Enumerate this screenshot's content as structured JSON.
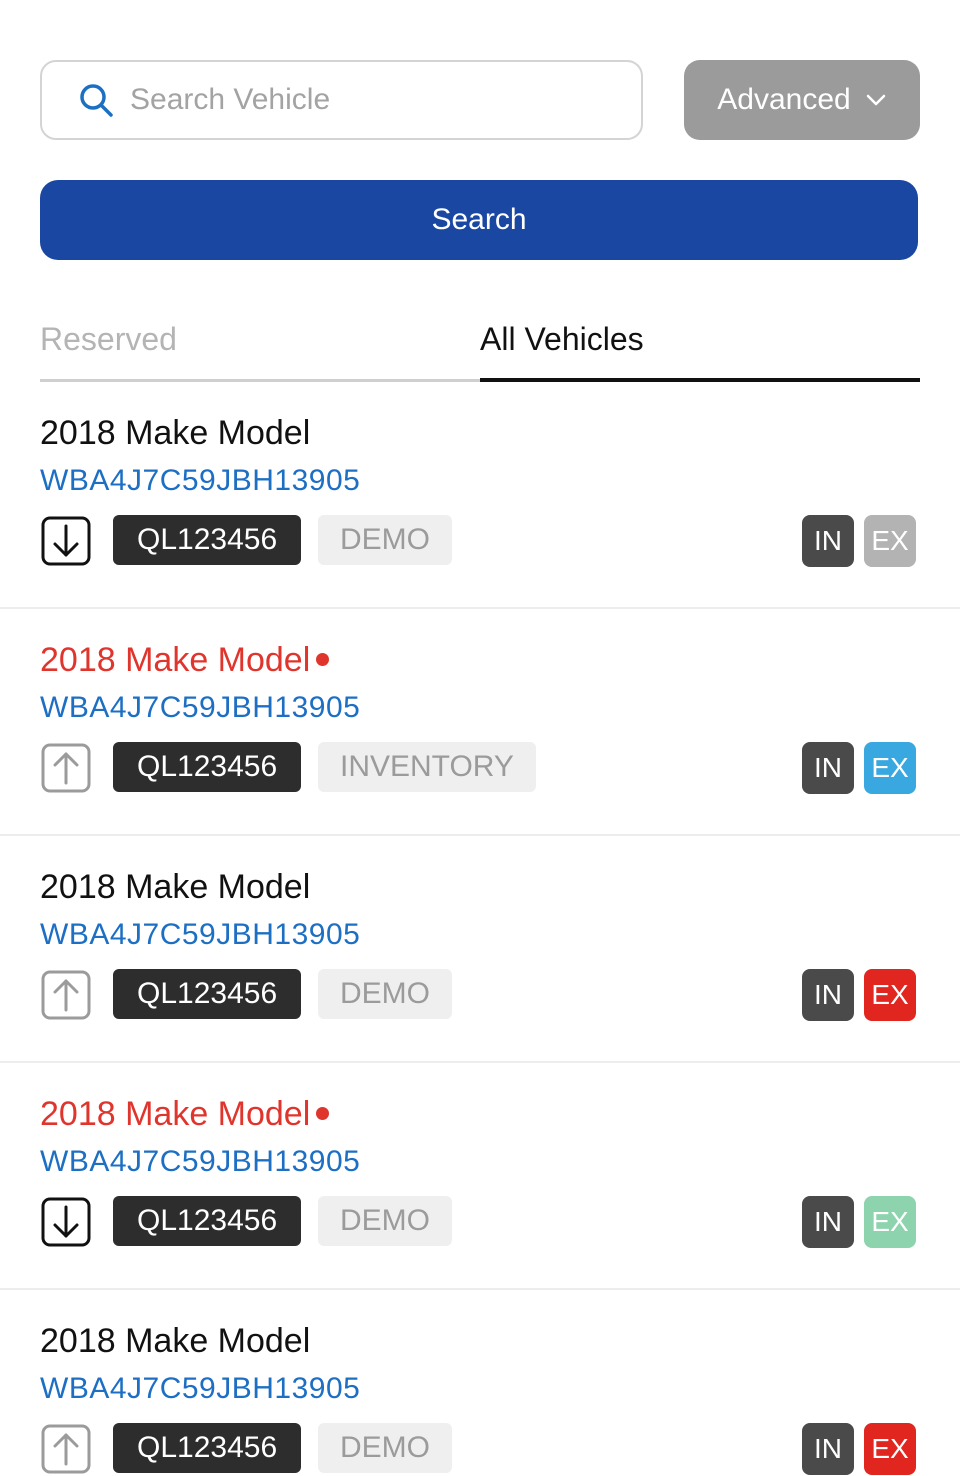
{
  "search": {
    "placeholder": "Search Vehicle",
    "advanced_label": "Advanced",
    "search_button_label": "Search"
  },
  "tabs": [
    {
      "label": "Reserved",
      "active": false
    },
    {
      "label": "All Vehicles",
      "active": true
    }
  ],
  "vehicles": [
    {
      "title": "2018 Make Model",
      "alert": false,
      "vin": "WBA4J7C59JBH13905",
      "direction": "download-icon",
      "stock": "QL123456",
      "type": "DEMO",
      "in_label": "IN",
      "ex_label": "EX",
      "ex_color": "#b3b3b3"
    },
    {
      "title": "2018 Make Model",
      "alert": true,
      "vin": "WBA4J7C59JBH13905",
      "direction": "upload-icon",
      "stock": "QL123456",
      "type": "INVENTORY",
      "in_label": "IN",
      "ex_label": "EX",
      "ex_color": "#3aa8e0"
    },
    {
      "title": "2018 Make Model",
      "alert": false,
      "vin": "WBA4J7C59JBH13905",
      "direction": "upload-icon",
      "stock": "QL123456",
      "type": "DEMO",
      "in_label": "IN",
      "ex_label": "EX",
      "ex_color": "#e0261f"
    },
    {
      "title": "2018 Make Model",
      "alert": true,
      "vin": "WBA4J7C59JBH13905",
      "direction": "download-icon",
      "stock": "QL123456",
      "type": "DEMO",
      "in_label": "IN",
      "ex_label": "EX",
      "ex_color": "#8dd3ad"
    },
    {
      "title": "2018 Make Model",
      "alert": false,
      "vin": "WBA4J7C59JBH13905",
      "direction": "upload-icon",
      "stock": "QL123456",
      "type": "DEMO",
      "in_label": "IN",
      "ex_label": "EX",
      "ex_color": "#e0261f"
    }
  ],
  "colors": {
    "primary": "#1a47a1",
    "link": "#1d6fc4",
    "alert": "#e0352d"
  }
}
